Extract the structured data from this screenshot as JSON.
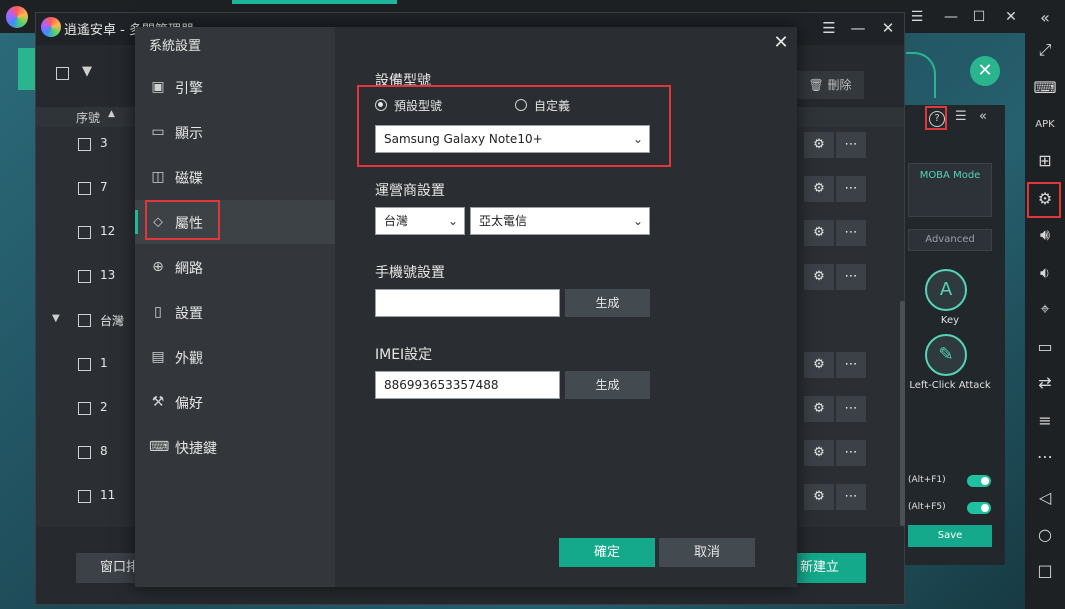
{
  "manager": {
    "title": "逍遙安卓 - 多開管理器",
    "delete_label": "刪除",
    "column_header": "序號",
    "group_label": "台灣",
    "rows": [
      "3",
      "7",
      "12",
      "13",
      "1",
      "2",
      "8",
      "11"
    ],
    "bottom_left_label": "窗口排",
    "bottom_right_label": "新建立"
  },
  "keymap": {
    "moba_label": "MOBA Mode",
    "advanced_label": "Advanced",
    "key_glyph": "A",
    "key_label": "Key",
    "attack_label": "Left-Click Attack",
    "toggle1_label": "(Alt+F1)",
    "toggle2_label": "(Alt+F5)",
    "save_label": "Save"
  },
  "dialog": {
    "title": "系統設置",
    "nav": [
      {
        "label": "引擎",
        "icon": "cpu-icon"
      },
      {
        "label": "顯示",
        "icon": "monitor-icon"
      },
      {
        "label": "磁碟",
        "icon": "disk-icon"
      },
      {
        "label": "屬性",
        "icon": "tag-icon"
      },
      {
        "label": "網路",
        "icon": "globe-icon"
      },
      {
        "label": "設置",
        "icon": "phone-icon"
      },
      {
        "label": "外觀",
        "icon": "window-icon"
      },
      {
        "label": "偏好",
        "icon": "wrench-icon"
      },
      {
        "label": "快捷鍵",
        "icon": "keyboard-icon"
      }
    ],
    "device_model_label": "設備型號",
    "radio_preset": "預設型號",
    "radio_custom": "自定義",
    "model_value": "Samsung Galaxy Note10+",
    "carrier_label": "運營商設置",
    "carrier_region": "台灣",
    "carrier_name": "亞太電信",
    "phone_label": "手機號設置",
    "phone_value": "",
    "phone_generate": "生成",
    "imei_label": "IMEI設定",
    "imei_value": "886993653357488",
    "imei_generate": "生成",
    "ok_label": "確定",
    "cancel_label": "取消"
  },
  "colors": {
    "accent": "#13a98a",
    "highlight": "#e0383a"
  }
}
